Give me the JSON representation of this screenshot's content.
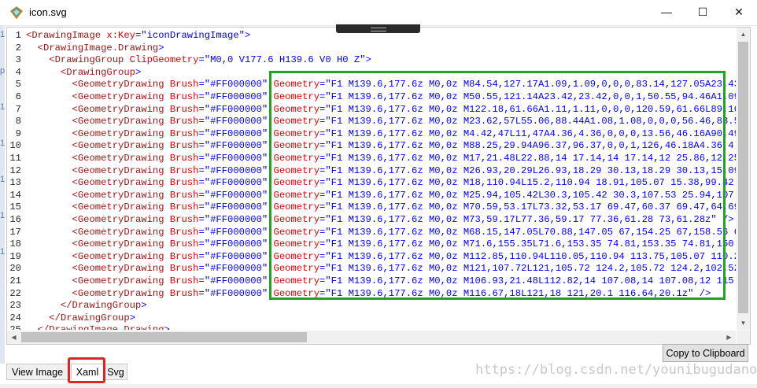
{
  "window": {
    "title": "icon.svg",
    "minimize_glyph": "—",
    "maximize_glyph": "☐",
    "close_glyph": "✕",
    "app_icon": "diamond-icon"
  },
  "left_strip_chars": [
    "1",
    "p",
    "1",
    "1",
    "1",
    "1",
    "1"
  ],
  "code": {
    "lines": [
      {
        "n": "1",
        "indent": "",
        "parts": [
          {
            "t": "<DrawingImage ",
            "c": "tag"
          },
          {
            "t": "x:Key",
            "c": "attr"
          },
          {
            "t": "=\"iconDrawingImage\"",
            "c": "val"
          },
          {
            "t": ">",
            "c": "punct"
          }
        ]
      },
      {
        "n": "2",
        "indent": "  ",
        "parts": [
          {
            "t": "<DrawingImage.Drawing",
            "c": "tag"
          },
          {
            "t": ">",
            "c": "punct"
          }
        ]
      },
      {
        "n": "3",
        "indent": "    ",
        "parts": [
          {
            "t": "<DrawingGroup ",
            "c": "tag"
          },
          {
            "t": "ClipGeometry",
            "c": "attr"
          },
          {
            "t": "=\"M0,0 V177.6 H139.6 V0 H0 Z\"",
            "c": "val"
          },
          {
            "t": ">",
            "c": "punct"
          }
        ]
      },
      {
        "n": "4",
        "indent": "      ",
        "parts": [
          {
            "t": "<DrawingGroup",
            "c": "tag"
          },
          {
            "t": ">",
            "c": "punct"
          }
        ]
      },
      {
        "n": "5",
        "indent": "        ",
        "parts": [
          {
            "t": "<GeometryDrawing ",
            "c": "tag"
          },
          {
            "t": "Brush",
            "c": "attr"
          },
          {
            "t": "=\"#FF000000\" ",
            "c": "val"
          },
          {
            "t": "Geometry",
            "c": "attr"
          },
          {
            "t": "=\"F1 M139.6,177.6z M0,0z M84.54,127.17A1.09,1.09,0,0,0,83.14,127.05A23.43",
            "c": "val"
          }
        ]
      },
      {
        "n": "6",
        "indent": "        ",
        "parts": [
          {
            "t": "<GeometryDrawing ",
            "c": "tag"
          },
          {
            "t": "Brush",
            "c": "attr"
          },
          {
            "t": "=\"#FF000000\" ",
            "c": "val"
          },
          {
            "t": "Geometry",
            "c": "attr"
          },
          {
            "t": "=\"F1 M139.6,177.6z M0,0z M50.55,121.14A23.42,23.42,0,0,1,50.55,94.46A1.09",
            "c": "val"
          }
        ]
      },
      {
        "n": "7",
        "indent": "        ",
        "parts": [
          {
            "t": "<GeometryDrawing ",
            "c": "tag"
          },
          {
            "t": "Brush",
            "c": "attr"
          },
          {
            "t": "=\"#FF000000\" ",
            "c": "val"
          },
          {
            "t": "Geometry",
            "c": "attr"
          },
          {
            "t": "=\"F1 M139.6,177.6z M0,0z M122.18,61.66A1.11,1.11,0,0,0,120.59,61.66L89.16",
            "c": "val"
          }
        ]
      },
      {
        "n": "8",
        "indent": "        ",
        "parts": [
          {
            "t": "<GeometryDrawing ",
            "c": "tag"
          },
          {
            "t": "Brush",
            "c": "attr"
          },
          {
            "t": "=\"#FF000000\" ",
            "c": "val"
          },
          {
            "t": "Geometry",
            "c": "attr"
          },
          {
            "t": "=\"F1 M139.6,177.6z M0,0z M23.62,57L55.06,88.44A1.08,1.08,0,0,0,56.46,88.51",
            "c": "val"
          }
        ]
      },
      {
        "n": "9",
        "indent": "        ",
        "parts": [
          {
            "t": "<GeometryDrawing ",
            "c": "tag"
          },
          {
            "t": "Brush",
            "c": "attr"
          },
          {
            "t": "=\"#FF000000\" ",
            "c": "val"
          },
          {
            "t": "Geometry",
            "c": "attr"
          },
          {
            "t": "=\"F1 M139.6,177.6z M0,0z M4.42,47L11,47A4.36,4.36,0,0,0,13.56,46.16A90.49",
            "c": "val"
          }
        ]
      },
      {
        "n": "10",
        "indent": "        ",
        "parts": [
          {
            "t": "<GeometryDrawing ",
            "c": "tag"
          },
          {
            "t": "Brush",
            "c": "attr"
          },
          {
            "t": "=\"#FF000000\" ",
            "c": "val"
          },
          {
            "t": "Geometry",
            "c": "attr"
          },
          {
            "t": "=\"F1 M139.6,177.6z M0,0z M88.25,29.94A96.37,96.37,0,0,1,126,46.18A4.36,4.3",
            "c": "val"
          }
        ]
      },
      {
        "n": "11",
        "indent": "        ",
        "parts": [
          {
            "t": "<GeometryDrawing ",
            "c": "tag"
          },
          {
            "t": "Brush",
            "c": "attr"
          },
          {
            "t": "=\"#FF000000\" ",
            "c": "val"
          },
          {
            "t": "Geometry",
            "c": "attr"
          },
          {
            "t": "=\"F1 M139.6,177.6z M0,0z M17,21.48L22.88,14 17.14,14 17.14,12 25.86,12 25.",
            "c": "val"
          }
        ]
      },
      {
        "n": "12",
        "indent": "        ",
        "parts": [
          {
            "t": "<GeometryDrawing ",
            "c": "tag"
          },
          {
            "t": "Brush",
            "c": "attr"
          },
          {
            "t": "=\"#FF000000\" ",
            "c": "val"
          },
          {
            "t": "Geometry",
            "c": "attr"
          },
          {
            "t": "=\"F1 M139.6,177.6z M0,0z M26.93,20.29L26.93,18.29 30.13,18.29 30.13,15.09",
            "c": "val"
          }
        ]
      },
      {
        "n": "13",
        "indent": "        ",
        "parts": [
          {
            "t": "<GeometryDrawing ",
            "c": "tag"
          },
          {
            "t": "Brush",
            "c": "attr"
          },
          {
            "t": "=\"#FF000000\" ",
            "c": "val"
          },
          {
            "t": "Geometry",
            "c": "attr"
          },
          {
            "t": "=\"F1 M139.6,177.6z M0,0z M18,110.94L15.2,110.94 18.91,105.07 15.38,99.42",
            "c": "val"
          }
        ]
      },
      {
        "n": "14",
        "indent": "        ",
        "parts": [
          {
            "t": "<GeometryDrawing ",
            "c": "tag"
          },
          {
            "t": "Brush",
            "c": "attr"
          },
          {
            "t": "=\"#FF000000\" ",
            "c": "val"
          },
          {
            "t": "Geometry",
            "c": "attr"
          },
          {
            "t": "=\"F1 M139.6,177.6z M0,0z M25.94,105.42L30.3,105.42 30.3,107.53 25.94,107.",
            "c": "val"
          }
        ]
      },
      {
        "n": "15",
        "indent": "        ",
        "parts": [
          {
            "t": "<GeometryDrawing ",
            "c": "tag"
          },
          {
            "t": "Brush",
            "c": "attr"
          },
          {
            "t": "=\"#FF000000\" ",
            "c": "val"
          },
          {
            "t": "Geometry",
            "c": "attr"
          },
          {
            "t": "=\"F1 M139.6,177.6z M0,0z M70.59,53.17L73.32,53.17 69.47,60.37 69.47,64.69",
            "c": "val"
          }
        ]
      },
      {
        "n": "16",
        "indent": "        ",
        "parts": [
          {
            "t": "<GeometryDrawing ",
            "c": "tag"
          },
          {
            "t": "Brush",
            "c": "attr"
          },
          {
            "t": "=\"#FF000000\" ",
            "c": "val"
          },
          {
            "t": "Geometry",
            "c": "attr"
          },
          {
            "t": "=\"F1 M139.6,177.6z M0,0z M73,59.17L77.36,59.17 77.36,61.28 73,61.28z\" />",
            "c": "val"
          }
        ]
      },
      {
        "n": "17",
        "indent": "        ",
        "parts": [
          {
            "t": "<GeometryDrawing ",
            "c": "tag"
          },
          {
            "t": "Brush",
            "c": "attr"
          },
          {
            "t": "=\"#FF000000\" ",
            "c": "val"
          },
          {
            "t": "Geometry",
            "c": "attr"
          },
          {
            "t": "=\"F1 M139.6,177.6z M0,0z M68.15,147.05L70.88,147.05 67,154.25 67,158.56 6",
            "c": "val"
          }
        ]
      },
      {
        "n": "18",
        "indent": "        ",
        "parts": [
          {
            "t": "<GeometryDrawing ",
            "c": "tag"
          },
          {
            "t": "Brush",
            "c": "attr"
          },
          {
            "t": "=\"#FF000000\" ",
            "c": "val"
          },
          {
            "t": "Geometry",
            "c": "attr"
          },
          {
            "t": "=\"F1 M139.6,177.6z M0,0z M71.6,155.35L71.6,153.35 74.81,153.35 74.81,150.",
            "c": "val"
          }
        ]
      },
      {
        "n": "19",
        "indent": "        ",
        "parts": [
          {
            "t": "<GeometryDrawing ",
            "c": "tag"
          },
          {
            "t": "Brush",
            "c": "attr"
          },
          {
            "t": "=\"#FF000000\" ",
            "c": "val"
          },
          {
            "t": "Geometry",
            "c": "attr"
          },
          {
            "t": "=\"F1 M139.6,177.6z M0,0z M112.85,110.94L110.05,110.94 113.75,105.07 110.2",
            "c": "val"
          }
        ]
      },
      {
        "n": "20",
        "indent": "        ",
        "parts": [
          {
            "t": "<GeometryDrawing ",
            "c": "tag"
          },
          {
            "t": "Brush",
            "c": "attr"
          },
          {
            "t": "=\"#FF000000\" ",
            "c": "val"
          },
          {
            "t": "Geometry",
            "c": "attr"
          },
          {
            "t": "=\"F1 M139.6,177.6z M0,0z M121,107.72L121,105.72 124.2,105.72 124.2,102.52",
            "c": "val"
          }
        ]
      },
      {
        "n": "21",
        "indent": "        ",
        "parts": [
          {
            "t": "<GeometryDrawing ",
            "c": "tag"
          },
          {
            "t": "Brush",
            "c": "attr"
          },
          {
            "t": "=\"#FF000000\" ",
            "c": "val"
          },
          {
            "t": "Geometry",
            "c": "attr"
          },
          {
            "t": "=\"F1 M139.6,177.6z M0,0z M106.93,21.48L112.82,14 107.08,14 107.08,12 115.",
            "c": "val"
          }
        ]
      },
      {
        "n": "22",
        "indent": "        ",
        "parts": [
          {
            "t": "<GeometryDrawing ",
            "c": "tag"
          },
          {
            "t": "Brush",
            "c": "attr"
          },
          {
            "t": "=\"#FF000000\" ",
            "c": "val"
          },
          {
            "t": "Geometry",
            "c": "attr"
          },
          {
            "t": "=\"F1 M139.6,177.6z M0,0z M116.67,18L121,18 121,20.1 116.64,20.1z\" />",
            "c": "val"
          }
        ]
      },
      {
        "n": "23",
        "indent": "      ",
        "parts": [
          {
            "t": "</DrawingGroup",
            "c": "tag"
          },
          {
            "t": ">",
            "c": "punct"
          }
        ]
      },
      {
        "n": "24",
        "indent": "    ",
        "parts": [
          {
            "t": "</DrawingGroup",
            "c": "tag"
          },
          {
            "t": ">",
            "c": "punct"
          }
        ]
      },
      {
        "n": "25",
        "indent": "  ",
        "parts": [
          {
            "t": "</DrawingImage.Drawing",
            "c": "tag"
          },
          {
            "t": ">",
            "c": "punct"
          }
        ]
      }
    ]
  },
  "buttons": {
    "copy_label": "Copy to Clipboard"
  },
  "tabs": [
    {
      "label": "View Image"
    },
    {
      "label": "Xaml"
    },
    {
      "label": "Svg"
    }
  ],
  "watermark": "https://blog.csdn.net/younibugudano",
  "colors": {
    "highlight_green": "#22a322",
    "highlight_red": "#e02424"
  }
}
